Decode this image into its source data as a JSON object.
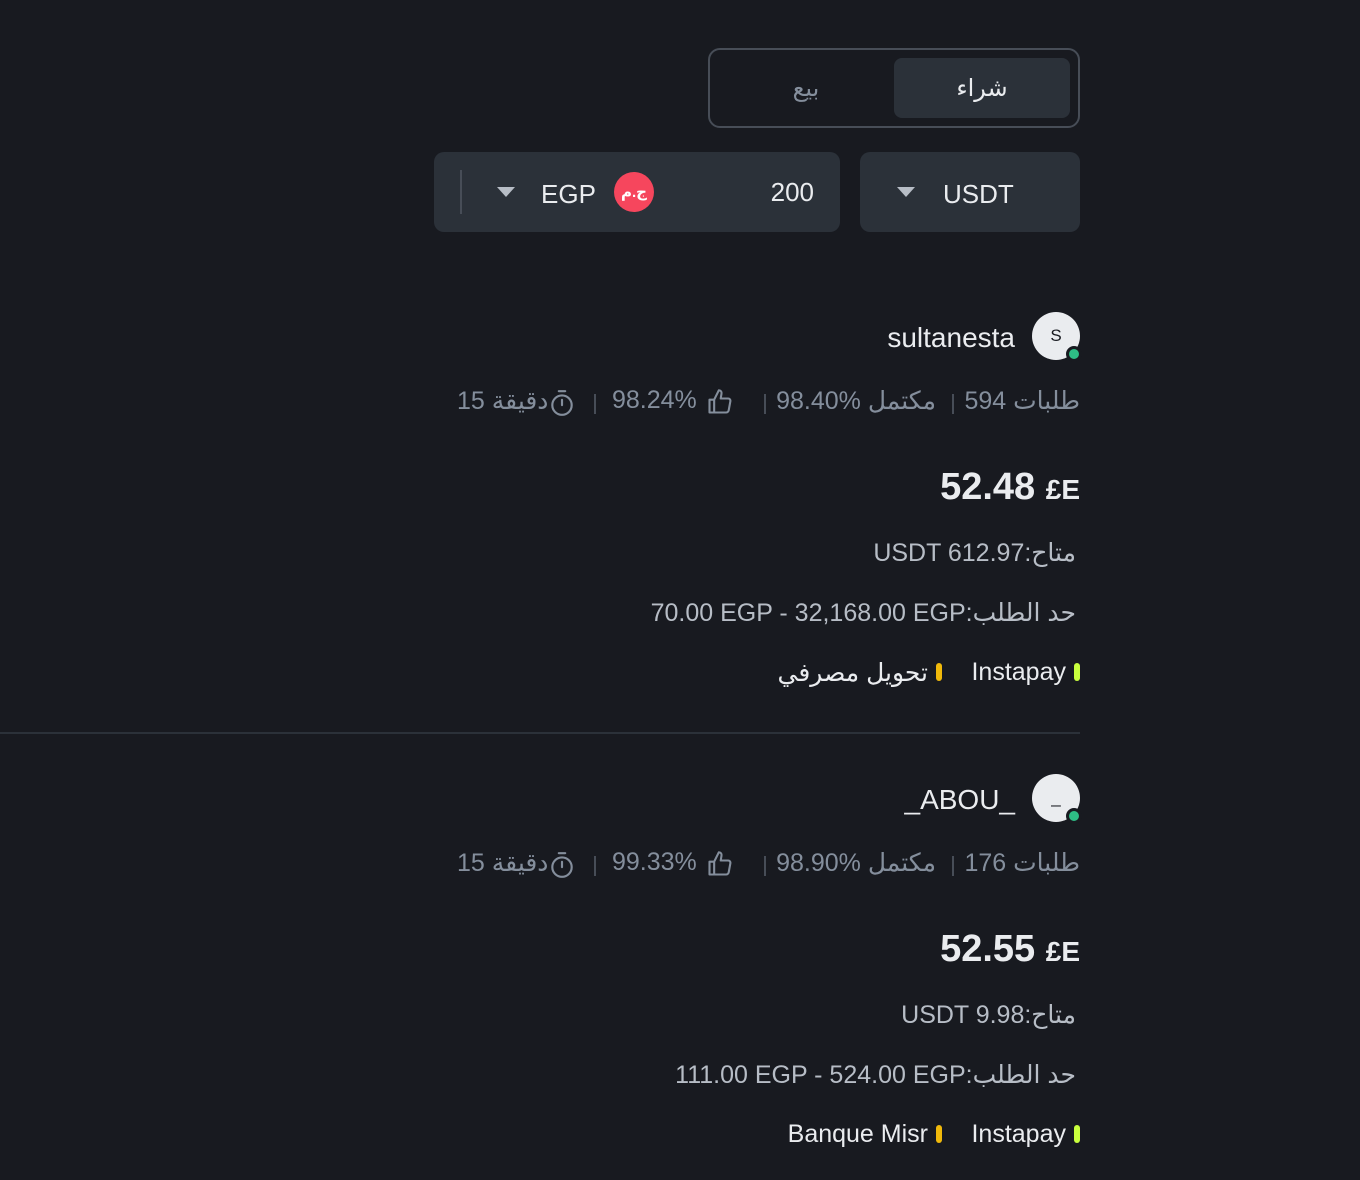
{
  "tabs": {
    "buy": "شراء",
    "sell": "بيع",
    "active": "buy"
  },
  "filters": {
    "amount": "200",
    "fiat": "EGP",
    "fiat_badge": "ج.م",
    "asset": "USDT"
  },
  "colors": {
    "background": "#181a20",
    "panel": "#2b3139",
    "online": "#2ebd85",
    "bank_transfer_bar": "#f0b90b",
    "instapay_bar": "#c9ff3d",
    "fiat_badge": "#f6465d"
  },
  "offers": [
    {
      "avatar_letter": "S",
      "username": "sultanesta",
      "orders": "594 طلبات",
      "completion": "98.40% مكتمل",
      "positive_rate": "98.24%",
      "response_time": "15 دقيقة",
      "price_value": "52.48",
      "price_currency": "£E",
      "available": "USDT 612.97:متاح",
      "limit": "70.00 EGP - 32,168.00 EGP:حد الطلب",
      "methods": [
        "Instapay",
        "تحويل مصرفي"
      ]
    },
    {
      "avatar_letter": "_",
      "username": "_ABOU_",
      "orders": "176 طلبات",
      "completion": "98.90% مكتمل",
      "positive_rate": "99.33%",
      "response_time": "15 دقيقة",
      "price_value": "52.55",
      "price_currency": "£E",
      "available": "USDT 9.98:متاح",
      "limit": "111.00 EGP - 524.00 EGP:حد الطلب",
      "methods": [
        "Instapay",
        "Banque Misr"
      ]
    }
  ]
}
